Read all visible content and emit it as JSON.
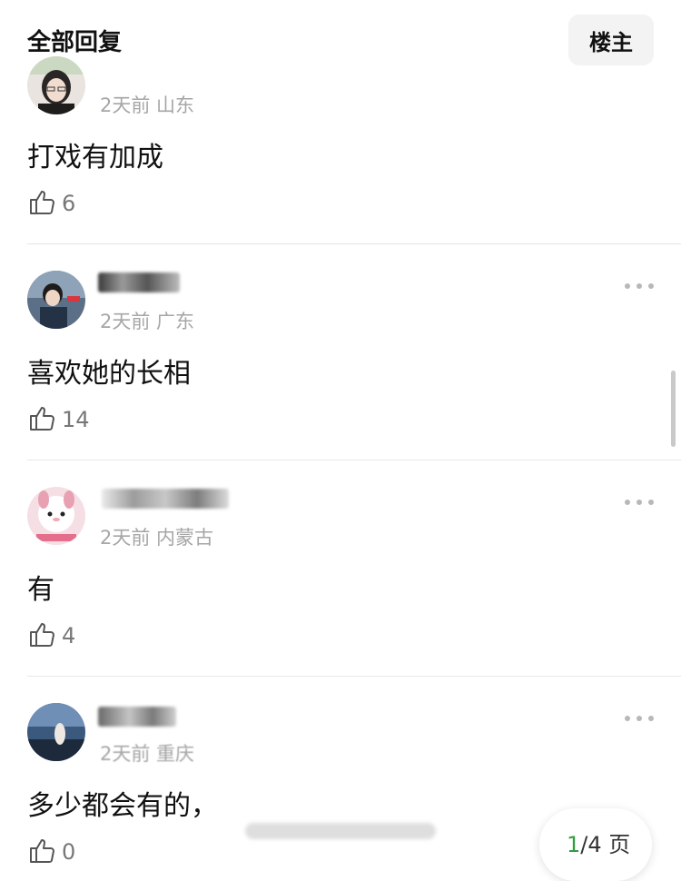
{
  "header": {
    "title": "全部回复",
    "op_button": "楼主"
  },
  "comments": [
    {
      "meta": "2天前 山东",
      "text": "打戏有加成",
      "likes": "6"
    },
    {
      "meta": "2天前 广东",
      "text": "喜欢她的长相",
      "likes": "14"
    },
    {
      "meta": "2天前 内蒙古",
      "text": "有",
      "likes": "4"
    },
    {
      "meta": "2天前 重庆",
      "text": "多少都会有的，",
      "likes": "0"
    }
  ],
  "pager": {
    "current": "1",
    "total_suffix": "/4 页"
  },
  "icons": {
    "like": "thumbs-up-icon",
    "more": "more-dots-icon"
  }
}
